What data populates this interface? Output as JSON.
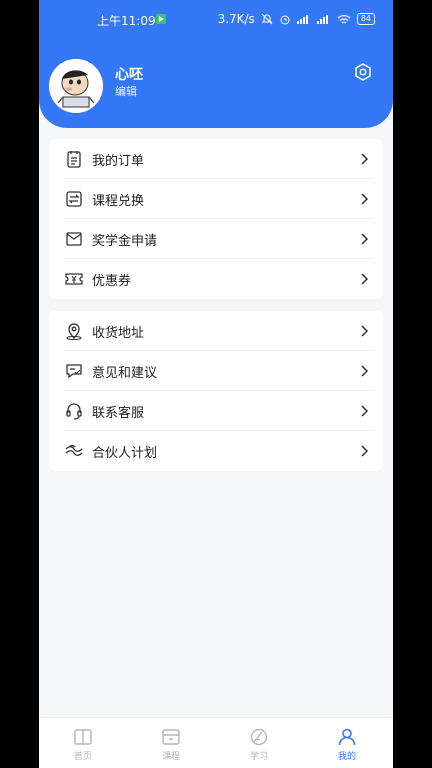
{
  "status_bar": {
    "time": "上午11:09",
    "net_speed": "3.7K/s",
    "battery": "84"
  },
  "profile": {
    "username": "心呸",
    "edit_label": "编辑"
  },
  "menu_group_1": [
    {
      "label": "我的订单",
      "icon": "order-icon"
    },
    {
      "label": "课程兑换",
      "icon": "exchange-icon"
    },
    {
      "label": "奖学金申请",
      "icon": "envelope-icon"
    },
    {
      "label": "优惠券",
      "icon": "coupon-icon"
    }
  ],
  "menu_group_2": [
    {
      "label": "收货地址",
      "icon": "location-icon"
    },
    {
      "label": "意见和建议",
      "icon": "feedback-icon"
    },
    {
      "label": "联系客服",
      "icon": "headset-icon"
    },
    {
      "label": "合伙人计划",
      "icon": "partner-icon"
    }
  ],
  "tabbar": [
    {
      "label": "首页",
      "icon": "home-book-icon",
      "active": false
    },
    {
      "label": "课程",
      "icon": "course-icon",
      "active": false
    },
    {
      "label": "学习",
      "icon": "study-icon",
      "active": false
    },
    {
      "label": "我的",
      "icon": "profile-icon",
      "active": true
    }
  ],
  "colors": {
    "primary": "#3478f6",
    "background": "#f5f6f8",
    "inactive_tab": "#b5b5b5"
  }
}
